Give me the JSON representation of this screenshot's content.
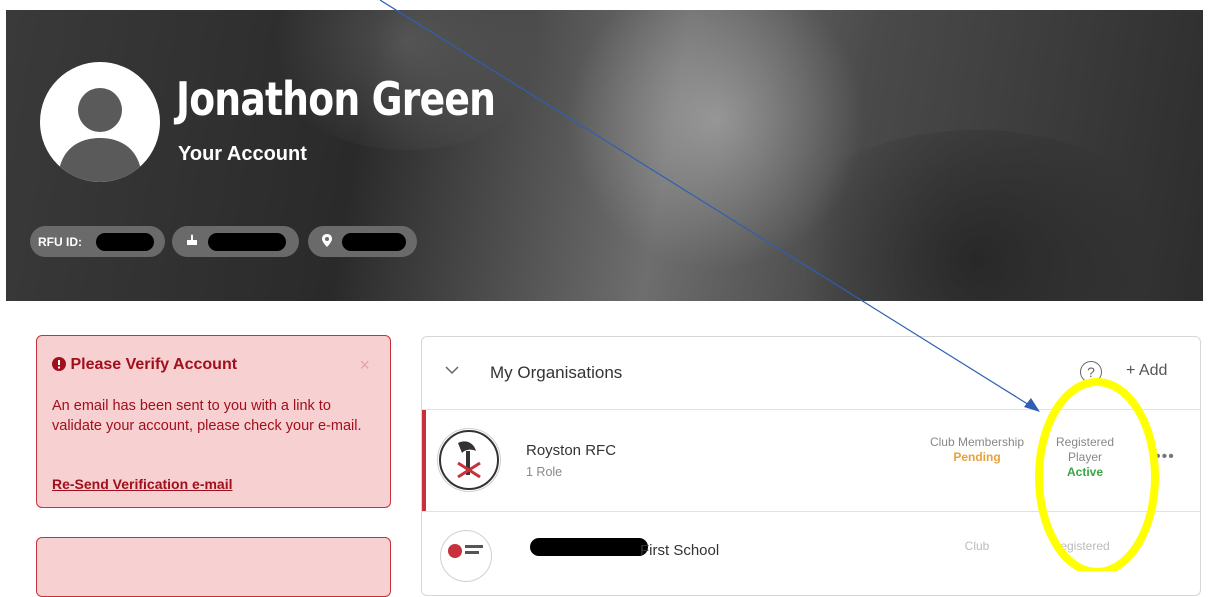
{
  "profile": {
    "name": "Jonathon Green",
    "subtitle": "Your Account",
    "rfu_label": "RFU ID:"
  },
  "alert": {
    "title": "Please Verify Account",
    "close": "×",
    "message": "An email has been sent to you with a link to validate your account, please check your e-mail.",
    "link": "Re-Send Verification e-mail"
  },
  "organisations": {
    "title": "My Organisations",
    "help": "?",
    "add": "+ Add",
    "rows": [
      {
        "name": "Royston RFC",
        "roles": "1 Role",
        "col_a_label": "Club Membership",
        "col_a_status": "Pending",
        "col_b_label": "Registered Player",
        "col_b_status": "Active",
        "menu": "•••"
      },
      {
        "name": "First School",
        "col_a_label": "Club",
        "col_b_label": "egistered"
      }
    ]
  },
  "colors": {
    "alert_text": "#a10f1c",
    "alert_bg": "#f7d0d2",
    "accent_red": "#c8303b",
    "pending": "#e8a23a",
    "active": "#3aa545",
    "annotation_arrow": "#2f5fb0",
    "annotation_ellipse": "#ffff00"
  }
}
